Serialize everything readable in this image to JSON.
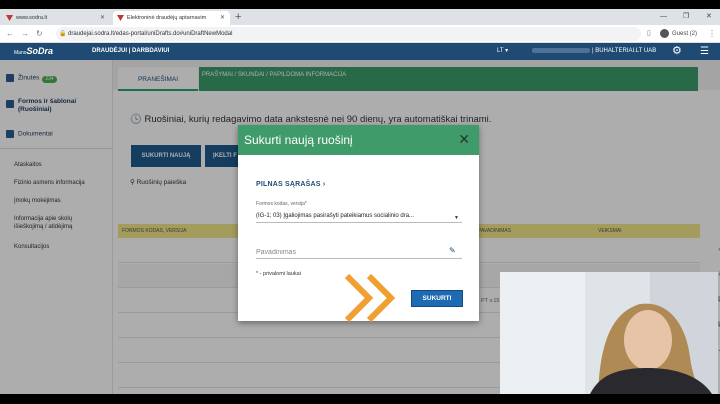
{
  "browser": {
    "tabs": [
      {
        "title": "www.sodra.lt"
      },
      {
        "title": "Elektroninė draudėjų aptarnavim"
      }
    ],
    "url": "draudejai.sodra.lt/edas-portal/uniDrafts.do#uniDraftNewModal",
    "profile": "Guest (2)"
  },
  "app": {
    "logo_prefix": "Mano",
    "logo_brand": "SoDra",
    "header_links": "DRAUDĖJUI | DARBDAVIUI",
    "lang": "LT",
    "company": "| BUHALTERIAI.LT UAB"
  },
  "sidebar": {
    "primary": [
      {
        "label": "Žinutės",
        "badge": "234"
      },
      {
        "label": "Formos ir šablonai (Ruošiniai)"
      },
      {
        "label": "Dokumentai"
      }
    ],
    "secondary": [
      {
        "label": "Ataskaitos"
      },
      {
        "label": "Fizinio asmens informacija"
      },
      {
        "label": "Įmokų mokėjimas"
      },
      {
        "label": "Informacija apie skolų išieškojimą / atidėjimą"
      },
      {
        "label": "Konsultacijos"
      }
    ]
  },
  "main": {
    "tabs": [
      {
        "label": "PRANEŠIMAI"
      },
      {
        "label": "PRAŠYMAI / SKUNDAI / PAPILDOMA INFORMACIJA"
      }
    ],
    "notice": "Ruošiniai, kurių redagavimo data ankstesnė nei 90 dienų, yra automatiškai trinami.",
    "buttons": {
      "create": "SUKURTI NAUJĄ",
      "import": "ĮKELTI F"
    },
    "filter": "Ruošinių paieška",
    "table": {
      "headers": [
        "FORMOS KODAS, VERSIJA",
        "PAVADINIMAS",
        "VEIKSMAI"
      ],
      "rows": [
        {
          "cells": [
            "",
            "PT v.15"
          ]
        },
        {
          "cells": [
            "",
            ""
          ]
        },
        {
          "cells": [
            "",
            ""
          ]
        },
        {
          "cells": [
            "",
            ""
          ]
        },
        {
          "cells": [
            "",
            ""
          ]
        },
        {
          "cells": [
            "",
            ""
          ]
        }
      ]
    }
  },
  "modal": {
    "title": "Sukurti naują ruošinį",
    "list_link": "PILNAS SĄRAŠAS",
    "form_label": "Formos kodas, versija*",
    "form_value": "(IG-1; 03) Įgaliojimas pasirašyti pateikiamus socialinio dra...",
    "name_placeholder": "Pavadinimas",
    "required_note": "* - privalomi laukai",
    "submit": "SUKURTI"
  },
  "colors": {
    "brand_blue": "#1e4a73",
    "modal_green": "#3f9b6a",
    "submit_blue": "#1f6bb3",
    "accent_orange": "#f0a030"
  }
}
